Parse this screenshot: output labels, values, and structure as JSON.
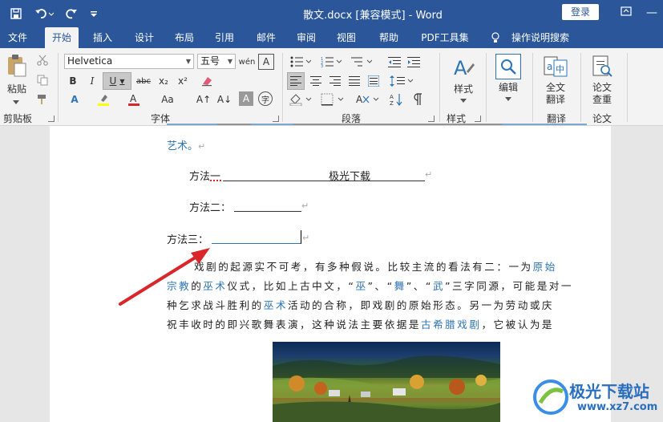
{
  "window": {
    "title": "散文.docx [兼容模式] - Word",
    "login_label": "登录",
    "quick_access": [
      "save-icon",
      "undo-icon",
      "redo-icon",
      "customize-icon"
    ],
    "controls": [
      "ribbon-display-icon",
      "minimize-icon",
      "maximize-icon"
    ]
  },
  "tabs": [
    "文件",
    "开始",
    "插入",
    "设计",
    "布局",
    "引用",
    "邮件",
    "审阅",
    "视图",
    "帮助",
    "PDF工具集",
    "操作说明搜索"
  ],
  "active_tab": "开始",
  "ribbon": {
    "clipboard": {
      "paste_label": "粘贴",
      "group_label": "剪贴板"
    },
    "font": {
      "font_name": "Helvetica",
      "font_size": "五号",
      "group_label": "字体",
      "buttons": [
        "B",
        "I",
        "U",
        "abc",
        "x₂",
        "x²",
        "A",
        "Aa",
        "A↑",
        "A↓",
        "A",
        "㊀"
      ]
    },
    "paragraph": {
      "group_label": "段落"
    },
    "styles": {
      "button_label": "样式",
      "group_label": "样式"
    },
    "editing": {
      "button_label": "编辑"
    },
    "translate": {
      "button_label_1": "全文",
      "button_label_2": "翻译",
      "group_label": "翻译"
    },
    "paper": {
      "button_label_1": "论文",
      "button_label_2": "查重",
      "group_label": "论文"
    }
  },
  "document": {
    "top_fragment": "艺术。",
    "method1_label": "方法一",
    "method1_value": "极光下载",
    "method2_label": "方法二：",
    "method3_label": "方法三：",
    "paragraph_lines": [
      [
        [
          "text",
          "戏剧的起源实不可考，有多种假说。比较主流的看法有二：一为"
        ],
        [
          "blue",
          "原始"
        ]
      ],
      [
        [
          "blue",
          "宗教"
        ],
        [
          "text",
          "的"
        ],
        [
          "blue",
          "巫术"
        ],
        [
          "text",
          "仪式，比如上古中文，“"
        ],
        [
          "blue",
          "巫"
        ],
        [
          "text",
          "”、“"
        ],
        [
          "blue",
          "舞"
        ],
        [
          "text",
          "”、“"
        ],
        [
          "blue",
          "武"
        ],
        [
          "text",
          "”三字同源，可能是对一"
        ]
      ],
      [
        [
          "text",
          "种乞求战斗胜利的"
        ],
        [
          "blue",
          "巫术"
        ],
        [
          "text",
          "活动的合称，即戏剧的原始形态。另一为劳动或庆"
        ]
      ],
      [
        [
          "text",
          "祝丰收时的即兴歌舞表演，这种说法主要依据是"
        ],
        [
          "blue",
          "古希腊戏剧"
        ],
        [
          "text",
          "，它被认为是"
        ]
      ]
    ]
  },
  "watermark": {
    "text": "极光下载站",
    "url": "www.xz7.com"
  },
  "colors": {
    "title_bar": "#2b579a",
    "ribbon": "#f3f3f3",
    "link_blue": "#2e74b5",
    "arrow_red": "#d9262b"
  }
}
